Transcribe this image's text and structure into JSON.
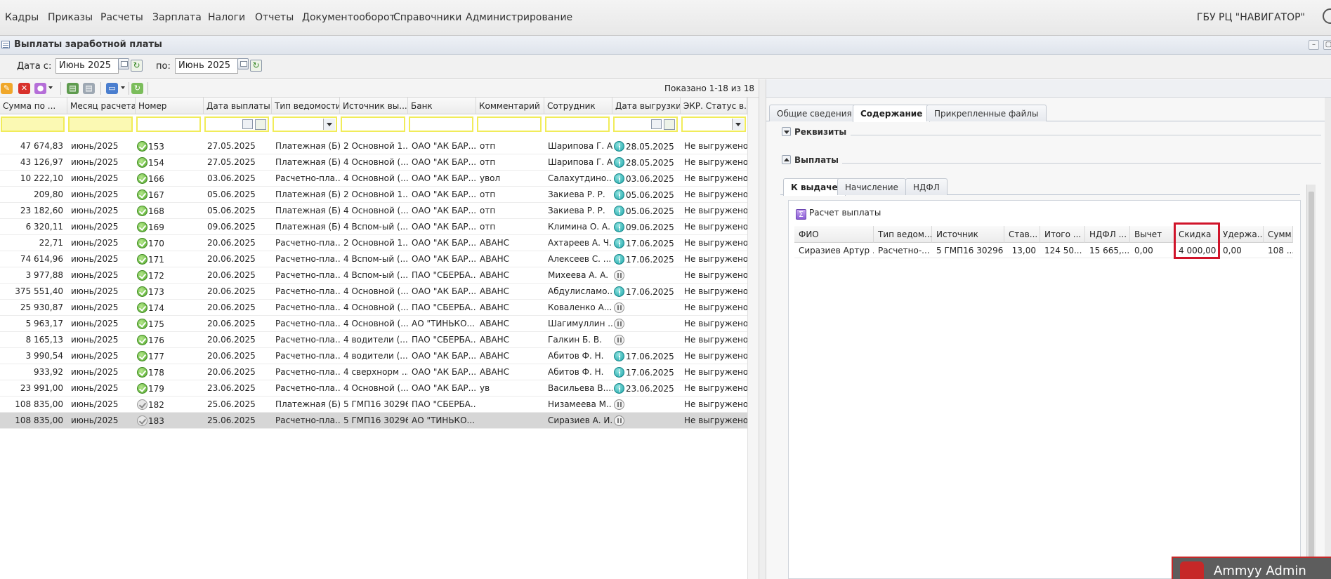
{
  "menu": {
    "items": [
      "Кадры",
      "Приказы",
      "Расчеты",
      "Зарплата",
      "Налоги",
      "Отчеты",
      "Документооборот",
      "Справочники",
      "Администрирование"
    ],
    "org": "ГБУ РЦ \"НАВИГАТОР\""
  },
  "panel": {
    "title": "Выплаты заработной платы"
  },
  "filter": {
    "date_from_label": "Дата с:",
    "date_from": "Июнь 2025",
    "date_to_label": "по:",
    "date_to": "Июнь 2025"
  },
  "toolbar": {
    "shown": "Показано 1-18 из 18"
  },
  "grid": {
    "columns": [
      "Сумма по ...",
      "Месяц расчета",
      "Номер",
      "Дата выплаты",
      "Тип ведомости",
      "Источник вы...",
      "Банк",
      "Комментарий",
      "Сотрудник",
      "Дата выгрузки",
      "ЭКР. Статус в..."
    ],
    "rows": [
      {
        "sum": "47 674,83",
        "month": "июнь/2025",
        "num": "153",
        "date": "27.05.2025",
        "type": "Платежная (Б)",
        "source": "2 Основной 1...",
        "bank": "ОАО \"АК БАР...",
        "comment": "отп",
        "employee": "Шарипова Г. А.",
        "export_date": "28.05.2025",
        "status": "Не выгружено",
        "state": "ok",
        "exp": "ok"
      },
      {
        "sum": "43 126,97",
        "month": "июнь/2025",
        "num": "154",
        "date": "27.05.2025",
        "type": "Платежная (Б)",
        "source": "4 Основной (...",
        "bank": "ОАО \"АК БАР...",
        "comment": "отп",
        "employee": "Шарипова Г. А.",
        "export_date": "28.05.2025",
        "status": "Не выгружено",
        "state": "ok",
        "exp": "ok"
      },
      {
        "sum": "10 222,10",
        "month": "июнь/2025",
        "num": "166",
        "date": "03.06.2025",
        "type": "Расчетно-пла...",
        "source": "4 Основной (...",
        "bank": "ОАО \"АК БАР...",
        "comment": "увол",
        "employee": "Салахутдино...",
        "export_date": "03.06.2025",
        "status": "Не выгружено",
        "state": "ok",
        "exp": "ok"
      },
      {
        "sum": "209,80",
        "month": "июнь/2025",
        "num": "167",
        "date": "05.06.2025",
        "type": "Платежная (Б)",
        "source": "2 Основной 1...",
        "bank": "ОАО \"АК БАР...",
        "comment": "отп",
        "employee": "Закиева Р. Р.",
        "export_date": "05.06.2025",
        "status": "Не выгружено",
        "state": "ok",
        "exp": "ok"
      },
      {
        "sum": "23 182,60",
        "month": "июнь/2025",
        "num": "168",
        "date": "05.06.2025",
        "type": "Платежная (Б)",
        "source": "4 Основной (...",
        "bank": "ОАО \"АК БАР...",
        "comment": "отп",
        "employee": "Закиева Р. Р.",
        "export_date": "05.06.2025",
        "status": "Не выгружено",
        "state": "ok",
        "exp": "ok"
      },
      {
        "sum": "6 320,11",
        "month": "июнь/2025",
        "num": "169",
        "date": "09.06.2025",
        "type": "Платежная (Б)",
        "source": "4 Вспом-ый (...",
        "bank": "ОАО \"АК БАР...",
        "comment": "отп",
        "employee": "Климина О. А.",
        "export_date": "09.06.2025",
        "status": "Не выгружено",
        "state": "ok",
        "exp": "ok"
      },
      {
        "sum": "22,71",
        "month": "июнь/2025",
        "num": "170",
        "date": "20.06.2025",
        "type": "Расчетно-пла...",
        "source": "2 Основной 1...",
        "bank": "ОАО \"АК БАР...",
        "comment": "АВАНС",
        "employee": "Ахтареев А. Ч.",
        "export_date": "17.06.2025",
        "status": "Не выгружено",
        "state": "ok",
        "exp": "ok"
      },
      {
        "sum": "74 614,96",
        "month": "июнь/2025",
        "num": "171",
        "date": "20.06.2025",
        "type": "Расчетно-пла...",
        "source": "4 Вспом-ый (...",
        "bank": "ОАО \"АК БАР...",
        "comment": "АВАНС",
        "employee": "Алексеев С. ...",
        "export_date": "17.06.2025",
        "status": "Не выгружено",
        "state": "ok",
        "exp": "ok"
      },
      {
        "sum": "3 977,88",
        "month": "июнь/2025",
        "num": "172",
        "date": "20.06.2025",
        "type": "Расчетно-пла...",
        "source": "4 Вспом-ый (...",
        "bank": "ПАО \"СБЕРБА...",
        "comment": "АВАНС",
        "employee": "Михеева А. А.",
        "export_date": "",
        "status": "Не выгружено",
        "state": "ok",
        "exp": "pause"
      },
      {
        "sum": "375 551,40",
        "month": "июнь/2025",
        "num": "173",
        "date": "20.06.2025",
        "type": "Расчетно-пла...",
        "source": "4 Основной (...",
        "bank": "ОАО \"АК БАР...",
        "comment": "АВАНС",
        "employee": "Абдулисламо...",
        "export_date": "17.06.2025",
        "status": "Не выгружено",
        "state": "ok",
        "exp": "ok"
      },
      {
        "sum": "25 930,87",
        "month": "июнь/2025",
        "num": "174",
        "date": "20.06.2025",
        "type": "Расчетно-пла...",
        "source": "4 Основной (...",
        "bank": "ПАО \"СБЕРБА...",
        "comment": "АВАНС",
        "employee": "Коваленко А....",
        "export_date": "",
        "status": "Не выгружено",
        "state": "ok",
        "exp": "pause"
      },
      {
        "sum": "5 963,17",
        "month": "июнь/2025",
        "num": "175",
        "date": "20.06.2025",
        "type": "Расчетно-пла...",
        "source": "4 Основной (...",
        "bank": "АО \"ТИНЬКО...",
        "comment": "АВАНС",
        "employee": "Шагимуллин ...",
        "export_date": "",
        "status": "Не выгружено",
        "state": "ok",
        "exp": "pause"
      },
      {
        "sum": "8 165,13",
        "month": "июнь/2025",
        "num": "176",
        "date": "20.06.2025",
        "type": "Расчетно-пла...",
        "source": "4 водители (...",
        "bank": "ПАО \"СБЕРБА...",
        "comment": "АВАНС",
        "employee": "Галкин Б. В.",
        "export_date": "",
        "status": "Не выгружено",
        "state": "ok",
        "exp": "pause"
      },
      {
        "sum": "3 990,54",
        "month": "июнь/2025",
        "num": "177",
        "date": "20.06.2025",
        "type": "Расчетно-пла...",
        "source": "4 водители (...",
        "bank": "ОАО \"АК БАР...",
        "comment": "АВАНС",
        "employee": "Абитов Ф. Н.",
        "export_date": "17.06.2025",
        "status": "Не выгружено",
        "state": "ok",
        "exp": "ok"
      },
      {
        "sum": "933,92",
        "month": "июнь/2025",
        "num": "178",
        "date": "20.06.2025",
        "type": "Расчетно-пла...",
        "source": "4 сверхнорм ...",
        "bank": "ОАО \"АК БАР...",
        "comment": "АВАНС",
        "employee": "Абитов Ф. Н.",
        "export_date": "17.06.2025",
        "status": "Не выгружено",
        "state": "ok",
        "exp": "ok"
      },
      {
        "sum": "23 991,00",
        "month": "июнь/2025",
        "num": "179",
        "date": "23.06.2025",
        "type": "Расчетно-пла...",
        "source": "4 Основной (...",
        "bank": "ОАО \"АК БАР...",
        "comment": "ув",
        "employee": "Васильева В....",
        "export_date": "23.06.2025",
        "status": "Не выгружено",
        "state": "ok",
        "exp": "ok"
      },
      {
        "sum": "108 835,00",
        "month": "июнь/2025",
        "num": "182",
        "date": "25.06.2025",
        "type": "Платежная (Б)",
        "source": "5 ГМП16 30296",
        "bank": "ПАО \"СБЕРБА...",
        "comment": "",
        "employee": "Низамеева М...",
        "export_date": "",
        "status": "Не выгружено",
        "state": "off",
        "exp": "pause"
      },
      {
        "sum": "108 835,00",
        "month": "июнь/2025",
        "num": "183",
        "date": "25.06.2025",
        "type": "Расчетно-пла...",
        "source": "5 ГМП16 30296",
        "bank": "АО \"ТИНЬКО...",
        "comment": "",
        "employee": "Сиразиев А. И.",
        "export_date": "",
        "status": "Не выгружено",
        "state": "off",
        "exp": "pause"
      }
    ]
  },
  "right": {
    "tabs": [
      "Общие сведения",
      "Содержание",
      "Прикрепленные файлы"
    ],
    "section_requisites": "Реквизиты",
    "section_payments": "Выплаты",
    "inner_tabs": [
      "К выдаче",
      "Начисление",
      "НДФЛ"
    ],
    "calc_button": "Расчет выплаты",
    "inner_columns": [
      "ФИО",
      "Тип ведом...",
      "Источник",
      "Став...",
      "Итого ...",
      "НДФЛ ...",
      "Вычет",
      "Скидка",
      "Удержа...",
      "Сумм..."
    ],
    "inner_row": [
      "Сиразиев Артур ...",
      "Расчетно-...",
      "5 ГМП16 30296",
      "13,00",
      "124 50...",
      "15 665,...",
      "0,00",
      "4 000,00",
      "0,00",
      "108 ..."
    ]
  },
  "overlay": {
    "ammyy": "Ammyy Admin"
  },
  "colors": {
    "highlight": "#d0142a",
    "filter_border": "#f1ec5a",
    "status_green": "#4fa628",
    "export_teal": "#1aa4a8"
  }
}
